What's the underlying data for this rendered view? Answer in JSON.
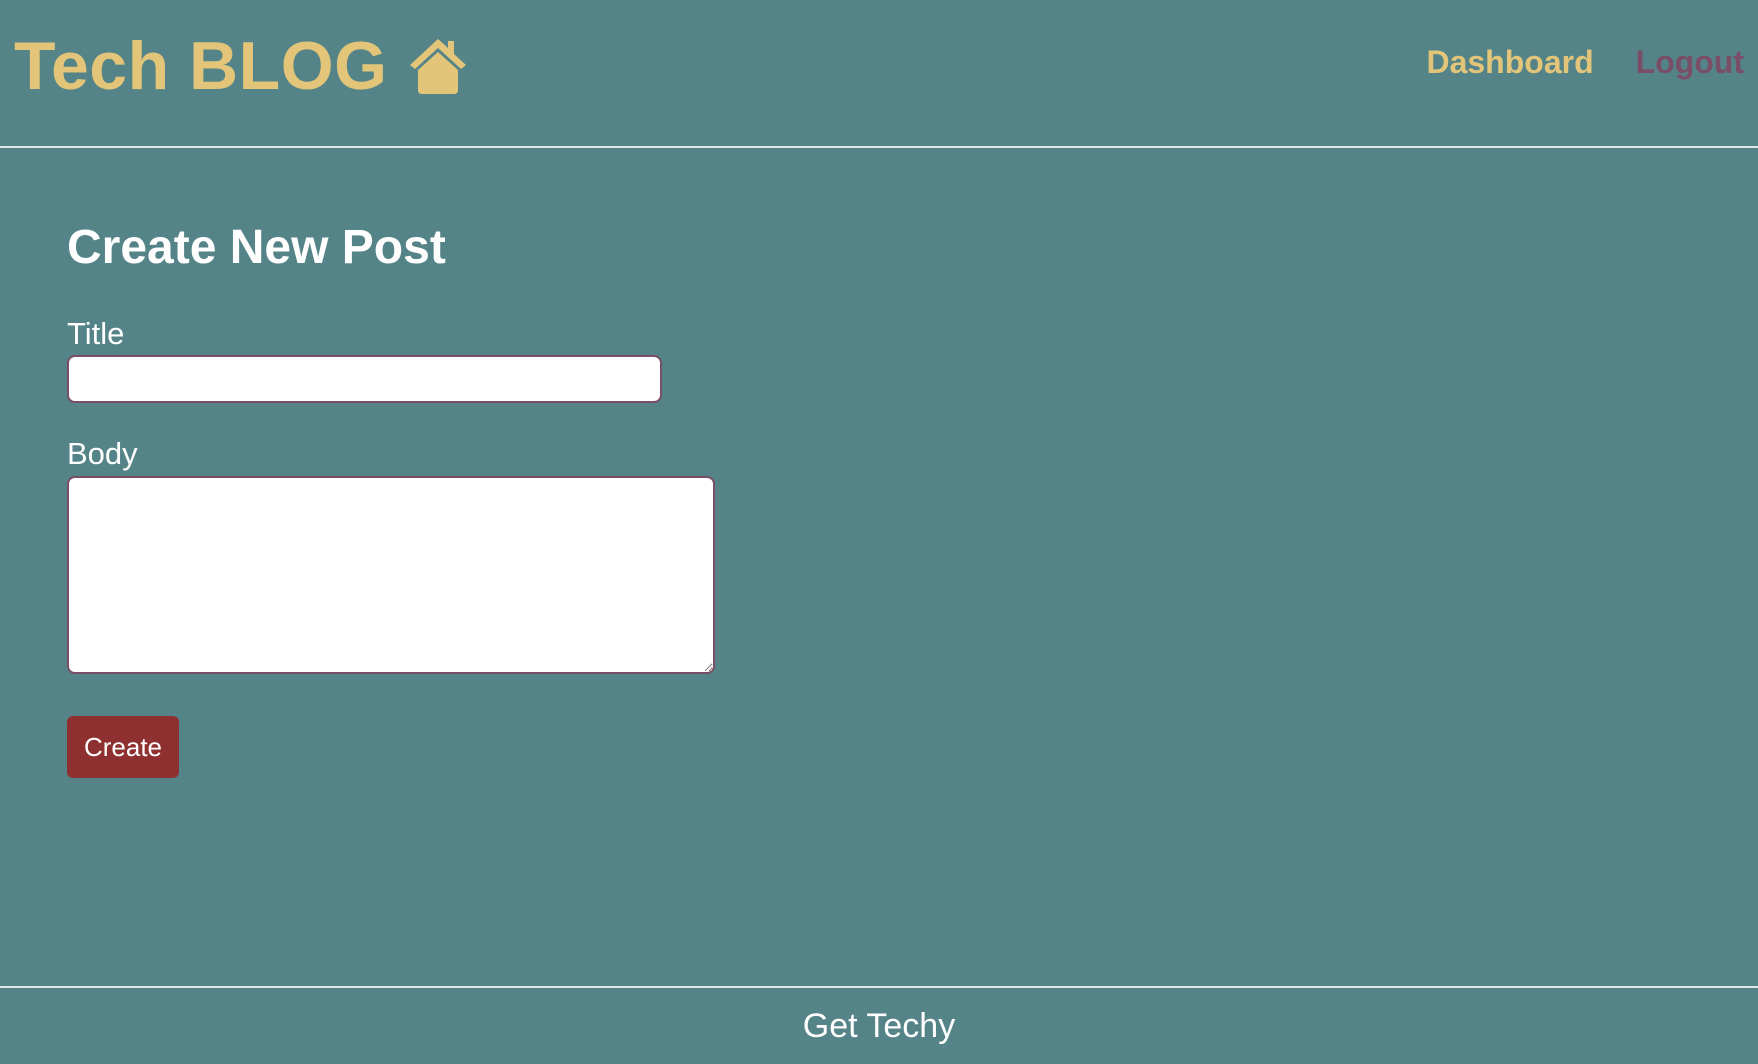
{
  "header": {
    "brand": "Tech BLOG",
    "brand_icon": "home-icon",
    "nav": {
      "dashboard": "Dashboard",
      "logout": "Logout"
    }
  },
  "main": {
    "heading": "Create New Post",
    "title_label": "Title",
    "title_value": "",
    "body_label": "Body",
    "body_value": "",
    "create_button": "Create"
  },
  "footer": {
    "text": "Get Techy"
  },
  "colors": {
    "background": "#548388",
    "brand": "#e2c579",
    "logout": "#7a4e67",
    "button": "#8e302f"
  }
}
